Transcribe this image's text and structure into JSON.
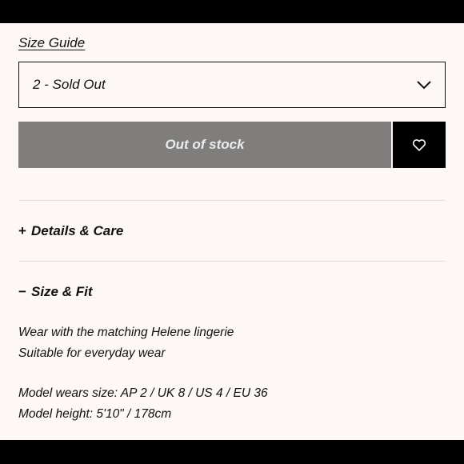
{
  "size_guide": {
    "label": "Size Guide"
  },
  "size_select": {
    "selected": "2 - Sold Out",
    "icon": "chevron-down-icon"
  },
  "cart": {
    "button_label": "Out of stock",
    "wishlist_icon": "heart-icon"
  },
  "accordions": [
    {
      "toggle": "+",
      "title": "Details & Care",
      "expanded": false
    },
    {
      "toggle": "−",
      "title": "Size & Fit",
      "expanded": true
    }
  ],
  "size_fit": {
    "lines": [
      "Wear with the matching Helene lingerie",
      "Suitable for everyday wear",
      "Model wears size: AP 2 / UK 8 / US 4 / EU 36",
      "Model height: 5'10\" / 178cm"
    ]
  },
  "colors": {
    "background": "#fdf8f5",
    "disabled_button": "#7f7e7c",
    "wishlist_button": "#000000",
    "divider": "#e4dfdb"
  }
}
